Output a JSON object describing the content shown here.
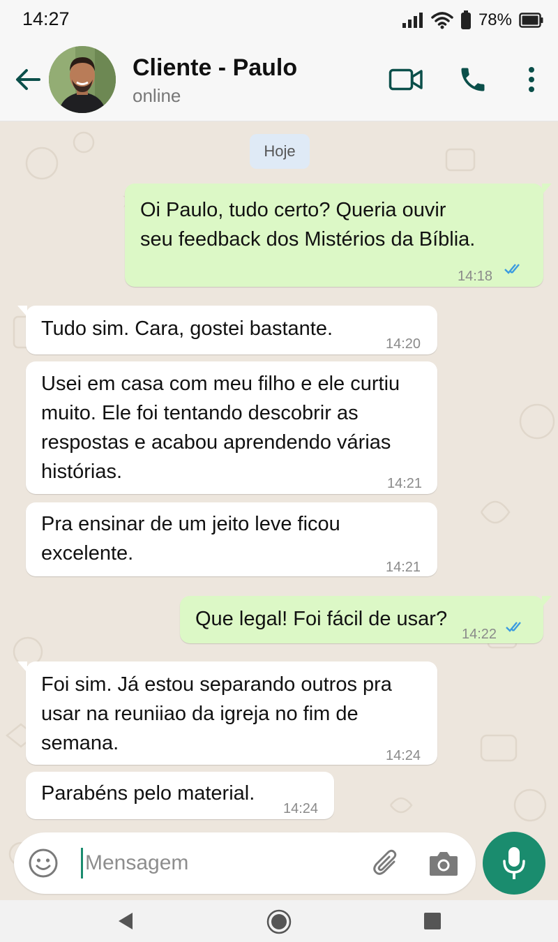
{
  "status_bar": {
    "time": "14:27",
    "battery": "78%"
  },
  "header": {
    "contact_name": "Cliente - Paulo",
    "contact_status": "online"
  },
  "chat": {
    "date_label": "Hoje",
    "messages": [
      {
        "direction": "out",
        "text": "Oi Paulo, tudo certo? Queria ouvir\nseu feedback dos Mistérios da Bíblia.",
        "time": "14:18",
        "read": true
      },
      {
        "direction": "in",
        "text": "Tudo sim. Cara, gostei bastante.",
        "time": "14:20"
      },
      {
        "direction": "in",
        "text": "Usei em casa com meu filho e ele curtiu\nmuito. Ele foi tentando descobrir as\nrespostas e acabou aprendendo várias\nhistórias.",
        "time": "14:21"
      },
      {
        "direction": "in",
        "text": "Pra ensinar de um jeito leve ficou\nexcelente.",
        "time": "14:21"
      },
      {
        "direction": "out",
        "text": "Que legal! Foi fácil de usar?",
        "time": "14:22",
        "read": true
      },
      {
        "direction": "in",
        "text": "Foi sim. Já estou separando outros pra\nusar na reuniiao da igreja no fim de\nsemana.",
        "time": "14:24"
      },
      {
        "direction": "in",
        "text": "Parabéns pelo material.",
        "time": "14:24"
      }
    ]
  },
  "input_bar": {
    "placeholder": "Mensagem"
  },
  "icons": {
    "back": "arrow-left-icon",
    "video": "video-call-icon",
    "call": "phone-icon",
    "menu": "more-vert-icon",
    "emoji": "emoji-icon",
    "attach": "paperclip-icon",
    "camera": "camera-icon",
    "mic": "microphone-icon"
  },
  "colors": {
    "accent": "#1a8c6e",
    "outgoing_bubble": "#dcf8c6",
    "incoming_bubble": "#ffffff",
    "chat_background": "#ede6dd",
    "read_ticks": "#3b9be0",
    "header_icons": "#0b4f4a"
  }
}
